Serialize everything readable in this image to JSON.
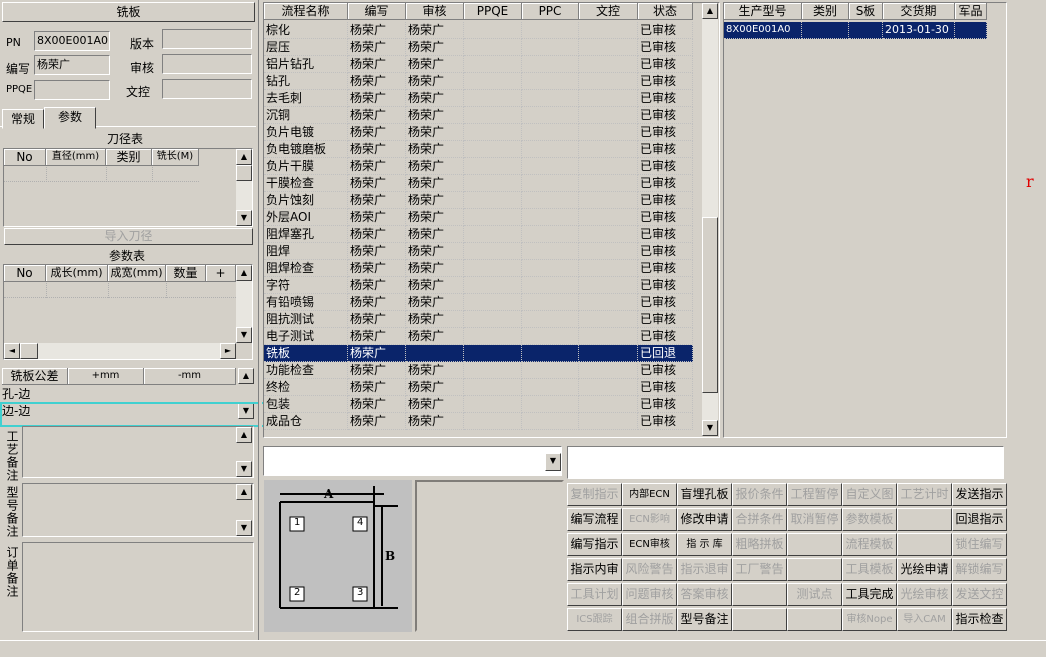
{
  "left": {
    "title": "铣板",
    "pn_label": "PN",
    "pn_value": "8X00E001A0",
    "version_label": "版本",
    "version_value": "",
    "author_label": "编写",
    "author_value": "杨荣广",
    "review_label": "审核",
    "review_value": "",
    "ppqe_label": "PPQE",
    "ppqe_value": "",
    "doc_label": "文控",
    "doc_value": "",
    "tabs": [
      "常规",
      "参数"
    ],
    "tool_table": {
      "title": "刀径表",
      "headers": [
        "No",
        "直径(mm)",
        "类别",
        "铣长(M)"
      ],
      "import_button": "导入刀径"
    },
    "param_table": {
      "title": "参数表",
      "headers": [
        "No",
        "成长(mm)",
        "成宽(mm)",
        "数量",
        "+"
      ]
    },
    "tolerance": {
      "headers": [
        "铣板公差",
        "+mm",
        "-mm"
      ],
      "rows": [
        "孔-边",
        "边-边"
      ]
    },
    "craft_note_label": "工艺备注",
    "model_note_label": "型号备注",
    "order_note_label": "订单备注"
  },
  "flow": {
    "headers": [
      "流程名称",
      "编写",
      "审核",
      "PPQE",
      "PPC",
      "文控",
      "状态"
    ],
    "rows": [
      [
        "棕化",
        "杨荣广",
        "杨荣广",
        "",
        "",
        "",
        "已审核"
      ],
      [
        "层压",
        "杨荣广",
        "杨荣广",
        "",
        "",
        "",
        "已审核"
      ],
      [
        "铝片钻孔",
        "杨荣广",
        "杨荣广",
        "",
        "",
        "",
        "已审核"
      ],
      [
        "钻孔",
        "杨荣广",
        "杨荣广",
        "",
        "",
        "",
        "已审核"
      ],
      [
        "去毛刺",
        "杨荣广",
        "杨荣广",
        "",
        "",
        "",
        "已审核"
      ],
      [
        "沉铜",
        "杨荣广",
        "杨荣广",
        "",
        "",
        "",
        "已审核"
      ],
      [
        "负片电镀",
        "杨荣广",
        "杨荣广",
        "",
        "",
        "",
        "已审核"
      ],
      [
        "负电镀磨板",
        "杨荣广",
        "杨荣广",
        "",
        "",
        "",
        "已审核"
      ],
      [
        "负片干膜",
        "杨荣广",
        "杨荣广",
        "",
        "",
        "",
        "已审核"
      ],
      [
        "干膜检查",
        "杨荣广",
        "杨荣广",
        "",
        "",
        "",
        "已审核"
      ],
      [
        "负片蚀刻",
        "杨荣广",
        "杨荣广",
        "",
        "",
        "",
        "已审核"
      ],
      [
        "外层AOI",
        "杨荣广",
        "杨荣广",
        "",
        "",
        "",
        "已审核"
      ],
      [
        "阻焊塞孔",
        "杨荣广",
        "杨荣广",
        "",
        "",
        "",
        "已审核"
      ],
      [
        "阻焊",
        "杨荣广",
        "杨荣广",
        "",
        "",
        "",
        "已审核"
      ],
      [
        "阻焊检查",
        "杨荣广",
        "杨荣广",
        "",
        "",
        "",
        "已审核"
      ],
      [
        "字符",
        "杨荣广",
        "杨荣广",
        "",
        "",
        "",
        "已审核"
      ],
      [
        "有铅喷锡",
        "杨荣广",
        "杨荣广",
        "",
        "",
        "",
        "已审核"
      ],
      [
        "阻抗测试",
        "杨荣广",
        "杨荣广",
        "",
        "",
        "",
        "已审核"
      ],
      [
        "电子测试",
        "杨荣广",
        "杨荣广",
        "",
        "",
        "",
        "已审核"
      ],
      [
        "铣板",
        "杨荣广",
        "",
        "",
        "",
        "",
        "已回退"
      ],
      [
        "功能检查",
        "杨荣广",
        "杨荣广",
        "",
        "",
        "",
        "已审核"
      ],
      [
        "终检",
        "杨荣广",
        "杨荣广",
        "",
        "",
        "",
        "已审核"
      ],
      [
        "包装",
        "杨荣广",
        "杨荣广",
        "",
        "",
        "",
        "已审核"
      ],
      [
        "成品仓",
        "杨荣广",
        "杨荣广",
        "",
        "",
        "",
        "已审核"
      ]
    ],
    "selected_index": 19
  },
  "orders": {
    "headers": [
      "生产型号",
      "类别",
      "S板",
      "交货期",
      "军品"
    ],
    "rows": [
      [
        "8X00E001A0",
        "",
        "",
        "2013-01-30",
        ""
      ]
    ]
  },
  "diagram": {
    "label_a": "A",
    "label_b": "B",
    "corners": [
      "1",
      "4",
      "2",
      "3"
    ]
  },
  "buttons": [
    [
      "复制指示",
      "内部ECN",
      "盲埋孔板",
      "报价条件",
      "工程暂停",
      "自定义图",
      "工艺计时",
      "发送指示"
    ],
    [
      "编写流程",
      "ECN影响",
      "修改申请",
      "合拼条件",
      "取消暂停",
      "参数模板",
      "",
      "回退指示"
    ],
    [
      "编写指示",
      "ECN审核",
      "指 示 库",
      "粗略拼板",
      "",
      "流程模板",
      "",
      "锁住编写"
    ],
    [
      "指示内审",
      "风险警告",
      "指示退审",
      "工厂警告",
      "",
      "工具模板",
      "光绘申请",
      "解锁编写"
    ],
    [
      "工具计划",
      "问题审核",
      "答案审核",
      "",
      "测试点",
      "工具完成",
      "光绘审核",
      "发送文控"
    ],
    [
      "ICS跟踪",
      "组合拼版",
      "型号备注",
      "",
      "",
      "审核Nope",
      "导入CAM",
      "指示检查"
    ]
  ],
  "buttons_enabled": [
    [
      false,
      true,
      true,
      false,
      false,
      false,
      false,
      true
    ],
    [
      true,
      false,
      true,
      false,
      false,
      false,
      false,
      true
    ],
    [
      true,
      true,
      true,
      false,
      false,
      false,
      false,
      false
    ],
    [
      true,
      false,
      false,
      false,
      false,
      false,
      true,
      false
    ],
    [
      false,
      false,
      false,
      false,
      false,
      true,
      false,
      false
    ],
    [
      false,
      false,
      true,
      false,
      false,
      false,
      false,
      true
    ]
  ],
  "colors": {
    "selection": "#0a246a",
    "highlight_box": "#40d0d0",
    "background": "#d4d0c8"
  }
}
